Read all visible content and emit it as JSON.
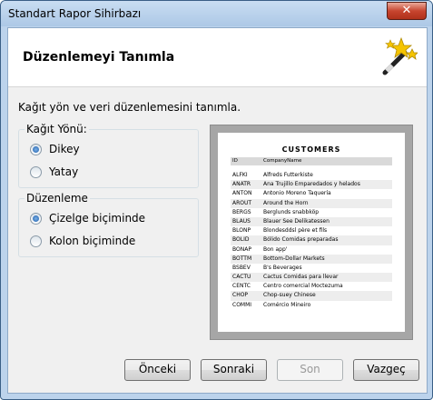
{
  "window": {
    "title": "Standart Rapor Sihirbazı",
    "close_symbol": "✕"
  },
  "header": {
    "title": "Düzenlemeyi Tanımla",
    "icon": "magic-wand-icon"
  },
  "intro_text": "Kağıt yön ve veri düzenlemesini tanımla.",
  "orientation_group": {
    "title": "Kağıt Yönü:",
    "options": [
      {
        "label": "Dikey",
        "selected": true
      },
      {
        "label": "Yatay",
        "selected": false
      }
    ]
  },
  "layout_group": {
    "title": "Düzenleme",
    "options": [
      {
        "label": "Çizelge biçiminde",
        "selected": true
      },
      {
        "label": "Kolon biçiminde",
        "selected": false
      }
    ]
  },
  "preview": {
    "report_title": "CUSTOMERS",
    "columns": [
      "ID",
      "CompanyName"
    ],
    "rows": [
      [
        "ALFKI",
        "Alfreds Futterkiste"
      ],
      [
        "ANATR",
        "Ana Trujillo Emparedados y helados"
      ],
      [
        "ANTON",
        "Antonio Moreno Taquería"
      ],
      [
        "AROUT",
        "Around the Horn"
      ],
      [
        "BERGS",
        "Berglunds snabbköp"
      ],
      [
        "BLAUS",
        "Blauer See Delikatessen"
      ],
      [
        "BLONP",
        "Blondesddsl père et fils"
      ],
      [
        "BOLID",
        "Bólido Comidas preparadas"
      ],
      [
        "BONAP",
        "Bon app'"
      ],
      [
        "BOTTM",
        "Bottom-Dollar Markets"
      ],
      [
        "BSBEV",
        "B's Beverages"
      ],
      [
        "CACTU",
        "Cactus Comidas para llevar"
      ],
      [
        "CENTC",
        "Centro comercial Moctezuma"
      ],
      [
        "CHOP",
        "Chop-suey Chinese"
      ],
      [
        "COMMI",
        "Comércio Mineiro"
      ]
    ]
  },
  "buttons": {
    "back": "Önceki",
    "next": "Sonraki",
    "finish": "Son",
    "cancel": "Vazgeç"
  }
}
